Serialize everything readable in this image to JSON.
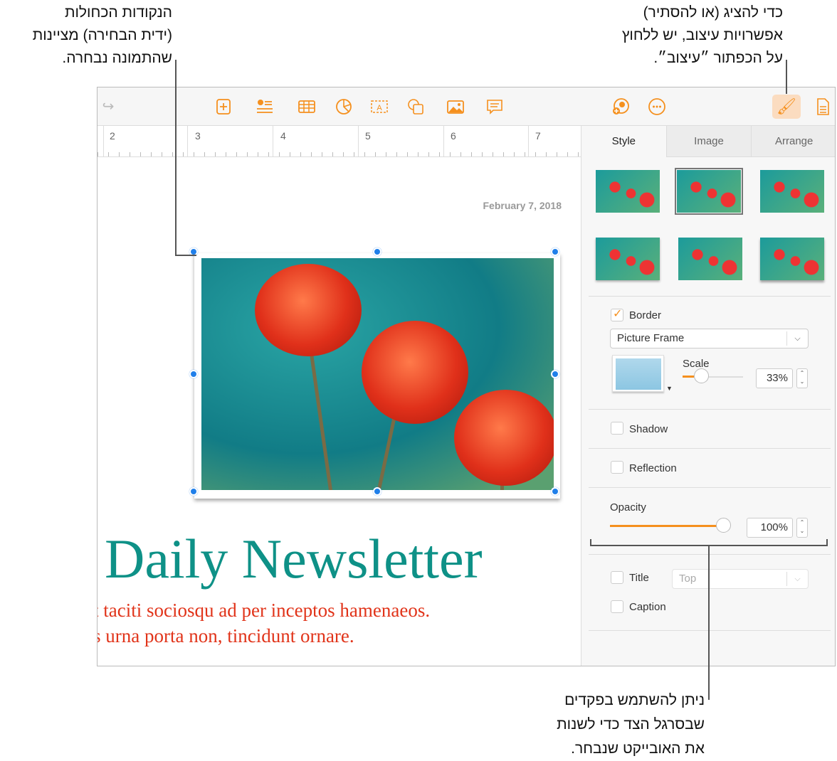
{
  "callouts": {
    "selection_handles": [
      "הנקודות הכחולות",
      "(ידית הבחירה) מציינות",
      "שהתמונה נבחרה."
    ],
    "format_button": [
      "כדי להציג (או להסתיר)",
      "אפשרויות עיצוב, יש ללחוץ",
      "על הכפתור ״עיצוב״."
    ],
    "sidebar": [
      "ניתן להשתמש בפקדים",
      "שבסרגל הצד כדי לשנות",
      "את האובייקט שנבחר."
    ]
  },
  "toolbar": {
    "icons": [
      "redo-icon",
      "insert-icon",
      "list-icon",
      "table-icon",
      "chart-icon",
      "textbox-icon",
      "shape-icon",
      "media-icon",
      "comment-icon",
      "collaborate-icon",
      "more-icon",
      "format-icon",
      "document-icon"
    ],
    "accent": "#f5901e"
  },
  "ruler": {
    "numbers": [
      "2",
      "3",
      "4",
      "5",
      "6",
      "7"
    ]
  },
  "document": {
    "date": "February 7, 2018",
    "title": "Daily Newsletter",
    "body_lines": [
      "t taciti sociosqu ad per inceptos hamenaeos.",
      "s urna porta non, tincidunt ornare."
    ],
    "title_color": "#0e9187",
    "body_color": "#e1341a"
  },
  "sidebar": {
    "tabs": [
      "Style",
      "Image",
      "Arrange"
    ],
    "active_tab": "Style",
    "border": {
      "label": "Border",
      "checked": true,
      "style": "Picture Frame",
      "scale_label": "Scale",
      "scale_value": "33%",
      "scale_fraction": 0.33
    },
    "shadow": {
      "label": "Shadow",
      "checked": false
    },
    "reflection": {
      "label": "Reflection",
      "checked": false
    },
    "opacity": {
      "label": "Opacity",
      "value": "100%",
      "fraction": 1.0
    },
    "title": {
      "label": "Title",
      "checked": false,
      "position": "Top"
    },
    "caption": {
      "label": "Caption",
      "checked": false
    }
  }
}
